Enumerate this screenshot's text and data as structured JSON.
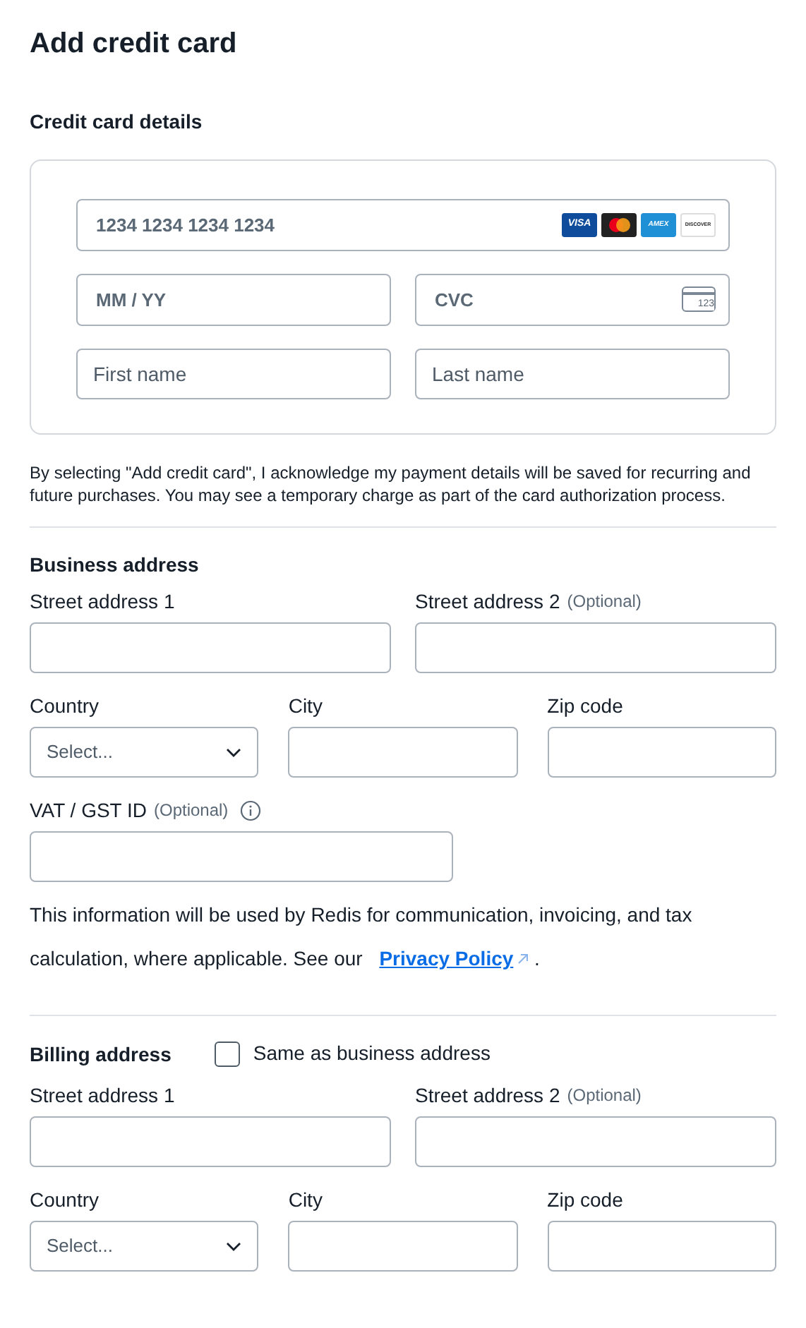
{
  "title": "Add credit card",
  "card_section": {
    "heading": "Credit card details",
    "card_number": {
      "placeholder": "1234 1234 1234 1234"
    },
    "card_brands": [
      {
        "kind": "visa",
        "label": "VISA"
      },
      {
        "kind": "mastercard"
      },
      {
        "kind": "amex",
        "label": "AMEX"
      },
      {
        "kind": "discover",
        "label": "DISCOVER"
      }
    ],
    "expiry": {
      "placeholder": "MM / YY"
    },
    "cvc": {
      "placeholder": "CVC",
      "icon_label": "123"
    },
    "first_name": {
      "placeholder": "First name"
    },
    "last_name": {
      "placeholder": "Last name"
    }
  },
  "disclaimer": "By selecting \"Add credit card\", I acknowledge my payment details will be saved for recurring and future purchases. You may see a temporary charge as part of the card authorization process.",
  "business_address": {
    "heading": "Business address",
    "street_fields": [
      {
        "kind": "text",
        "label": "Street address 1"
      },
      {
        "kind": "text",
        "label": "Street address 2",
        "optional": "(Optional)"
      }
    ],
    "location_fields": [
      {
        "kind": "select",
        "label": "Country",
        "placeholder": "Select..."
      },
      {
        "kind": "text",
        "label": "City"
      },
      {
        "kind": "text",
        "label": "Zip code"
      }
    ],
    "tax_fields": [
      {
        "kind": "text",
        "label": "VAT / GST ID",
        "optional": "(Optional)",
        "info": true
      }
    ],
    "notice": {
      "text": "This information will be used by Redis for communication, invoicing, and tax calculation, where applicable. See our",
      "link": "Privacy Policy",
      "trailing": "."
    }
  },
  "billing_address": {
    "heading": "Billing address",
    "same_as_business": {
      "label": "Same as business address",
      "checked": false
    },
    "street_fields": [
      {
        "kind": "text",
        "label": "Street address 1"
      },
      {
        "kind": "text",
        "label": "Street address 2",
        "optional": "(Optional)"
      }
    ],
    "location_fields": [
      {
        "kind": "select",
        "label": "Country",
        "placeholder": "Select..."
      },
      {
        "kind": "text",
        "label": "City"
      },
      {
        "kind": "text",
        "label": "Zip code"
      }
    ]
  }
}
